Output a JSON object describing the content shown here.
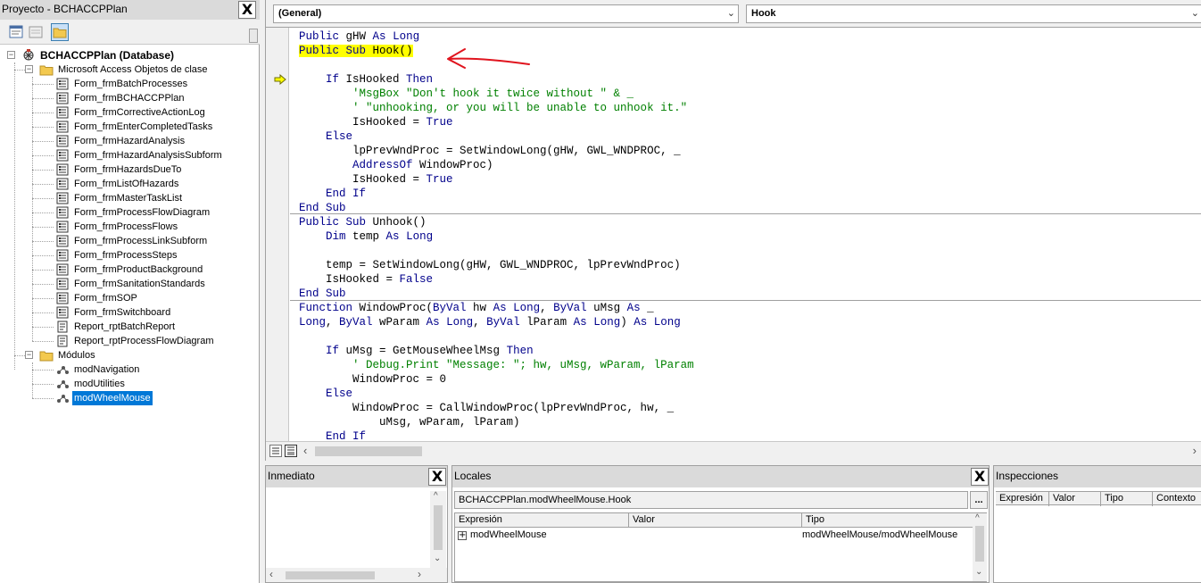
{
  "project": {
    "title": "Proyecto - BCHACCPPlan",
    "close_label": "X",
    "root_label": "BCHACCPPlan (Database)",
    "folder_classes": "Microsoft Access Objetos de clase",
    "class_items": [
      "Form_frmBatchProcesses",
      "Form_frmBCHACCPPlan",
      "Form_frmCorrectiveActionLog",
      "Form_frmEnterCompletedTasks",
      "Form_frmHazardAnalysis",
      "Form_frmHazardAnalysisSubform",
      "Form_frmHazardsDueTo",
      "Form_frmListOfHazards",
      "Form_frmMasterTaskList",
      "Form_frmProcessFlowDiagram",
      "Form_frmProcessFlows",
      "Form_frmProcessLinkSubform",
      "Form_frmProcessSteps",
      "Form_frmProductBackground",
      "Form_frmSanitationStandards",
      "Form_frmSOP",
      "Form_frmSwitchboard",
      "Report_rptBatchReport",
      "Report_rptProcessFlowDiagram"
    ],
    "folder_modules": "Módulos",
    "module_items": [
      "modNavigation",
      "modUtilities",
      "modWheelMouse"
    ],
    "selected_module": "modWheelMouse"
  },
  "editor": {
    "object_combo": "(General)",
    "proc_combo": "Hook",
    "lines": [
      [
        {
          "t": "Public gHW As Long",
          "c": "kw"
        }
      ],
      [
        {
          "t": "Public Sub Hook()",
          "c": "kw hl"
        }
      ],
      [
        {
          "t": "",
          "c": ""
        }
      ],
      [
        {
          "t": "    If IsHooked Then",
          "c": "kw"
        }
      ],
      [
        {
          "t": "        'MsgBox \"Don't hook it twice without \" & _",
          "c": "cm"
        }
      ],
      [
        {
          "t": "        ' \"unhooking, or you will be unable to unhook it.\"",
          "c": "cm"
        }
      ],
      [
        {
          "t": "        IsHooked = True",
          "c": "kw"
        }
      ],
      [
        {
          "t": "    Else",
          "c": "kw"
        }
      ],
      [
        {
          "t": "        lpPrevWndProc = SetWindowLong(gHW, GWL_WNDPROC, _",
          "c": ""
        }
      ],
      [
        {
          "t": "        AddressOf WindowProc)",
          "c": "kw"
        }
      ],
      [
        {
          "t": "        IsHooked = True",
          "c": "kw"
        }
      ],
      [
        {
          "t": "    End If",
          "c": "kw"
        }
      ],
      [
        {
          "t": "End Sub",
          "c": "kw"
        }
      ],
      [
        {
          "t": "Public Sub Unhook()",
          "c": "kw"
        }
      ],
      [
        {
          "t": "    Dim temp As Long",
          "c": "kw"
        }
      ],
      [
        {
          "t": "",
          "c": ""
        }
      ],
      [
        {
          "t": "    temp = SetWindowLong(gHW, GWL_WNDPROC, lpPrevWndProc)",
          "c": ""
        }
      ],
      [
        {
          "t": "    IsHooked = False",
          "c": "kw"
        }
      ],
      [
        {
          "t": "End Sub",
          "c": "kw"
        }
      ],
      [
        {
          "t": "Function WindowProc(ByVal hw As Long, ByVal uMsg As _",
          "c": "kw"
        }
      ],
      [
        {
          "t": "Long, ByVal wParam As Long, ByVal lParam As Long) As Long",
          "c": "kw"
        }
      ],
      [
        {
          "t": "",
          "c": ""
        }
      ],
      [
        {
          "t": "    If uMsg = GetMouseWheelMsg Then",
          "c": "kw"
        }
      ],
      [
        {
          "t": "        ' Debug.Print \"Message: \"; hw, uMsg, wParam, lParam",
          "c": "cm"
        }
      ],
      [
        {
          "t": "        WindowProc = 0",
          "c": ""
        }
      ],
      [
        {
          "t": "    Else",
          "c": "kw"
        }
      ],
      [
        {
          "t": "        WindowProc = CallWindowProc(lpPrevWndProc, hw, _",
          "c": ""
        }
      ],
      [
        {
          "t": "            uMsg, wParam, lParam)",
          "c": ""
        }
      ],
      [
        {
          "t": "    End If",
          "c": "kw"
        }
      ]
    ]
  },
  "immediate": {
    "title": "Inmediato",
    "close_label": "X"
  },
  "locals": {
    "title": "Locales",
    "close_label": "X",
    "context": "BCHACCPPlan.modWheelMouse.Hook",
    "ellipsis": "...",
    "columns": [
      "Expresión",
      "Valor",
      "Tipo"
    ],
    "rows": [
      {
        "expr": "modWheelMouse",
        "value": "",
        "type": "modWheelMouse/modWheelMouse"
      }
    ]
  },
  "watches": {
    "title": "Inspecciones",
    "columns": [
      "Expresión",
      "Valor",
      "Tipo",
      "Contexto"
    ]
  }
}
